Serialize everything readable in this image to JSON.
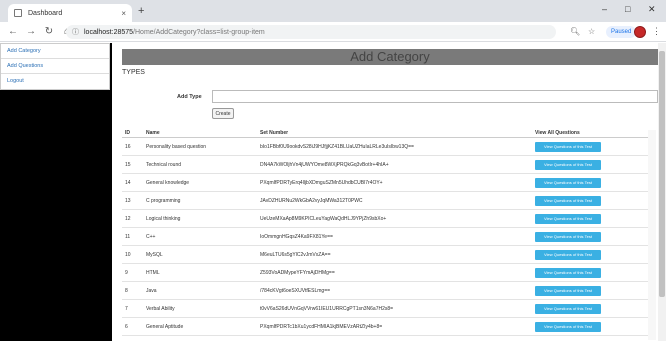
{
  "browser": {
    "tab_title": "Dashboard",
    "tab_close": "×",
    "new_tab": "+",
    "address_host": "localhost:28575",
    "address_path": "/Home/AddCategory?class=list-group-item",
    "paused_label": "Paused",
    "win_minimize": "–",
    "win_maximize": "□",
    "win_close": "✕"
  },
  "sidebar": {
    "items": [
      {
        "label": "Add Category"
      },
      {
        "label": "Add Questions"
      },
      {
        "label": "Logout"
      }
    ]
  },
  "main": {
    "header": "Add Category",
    "types_label": "TYPES",
    "add_type_label": "Add Type",
    "add_type_value": "",
    "create_label": "Create"
  },
  "table": {
    "headers": {
      "id": "ID",
      "name": "Name",
      "set": "Set Number",
      "view": "View All Questions"
    },
    "view_button_label": "View Questions of this Test",
    "rows": [
      {
        "id": "16",
        "name": "Personality based question",
        "set": "bIo1FBbf0U9ookdvS28iJ9HJfjjKZ41BLUaUZHuIaLRLe3uIsIbw13Q=="
      },
      {
        "id": "15",
        "name": "Technical round",
        "set": "DN4A7kWOljhVn4jUWYOme8WXjPRQkGq3vBotIr+4hIA+"
      },
      {
        "id": "14",
        "name": "General knowledge",
        "set": "PXqmIfPDRTyErq4lljbXDmguSZMn5UhdbCUBl7r4OY+"
      },
      {
        "id": "13",
        "name": "C programming",
        "set": "JAvDZHURNu2WkGbA2vyJqMWa312T0PWC"
      },
      {
        "id": "12",
        "name": "Logical thinking",
        "set": "UeUzeMXaAp8M9KPICLeuYagWaQdHLJ9YPjZh9sbXo+"
      },
      {
        "id": "11",
        "name": "C++",
        "set": "IoOmmgnHGqsZ4Ka9FX81Ye=="
      },
      {
        "id": "10",
        "name": "MySQL",
        "set": "M6euLTU6s5gYlC2vJmVxZA=="
      },
      {
        "id": "9",
        "name": "HTML",
        "set": "Z593VoADMypeYFYmAjDHMg=="
      },
      {
        "id": "8",
        "name": "Java",
        "set": "/784cKVgt6oeSXUVtfESLmg=="
      },
      {
        "id": "7",
        "name": "Verbal Ability",
        "set": "t0vV6aS26dUVnGqVVrw61IEU1URRCgPT1sn3N6a7H2s8="
      },
      {
        "id": "6",
        "name": "General Aptitude",
        "set": "PXqmIfPDRTc1bXu1ycdFHMIA1kjBMEVzARtZIy4b+8="
      }
    ]
  }
}
